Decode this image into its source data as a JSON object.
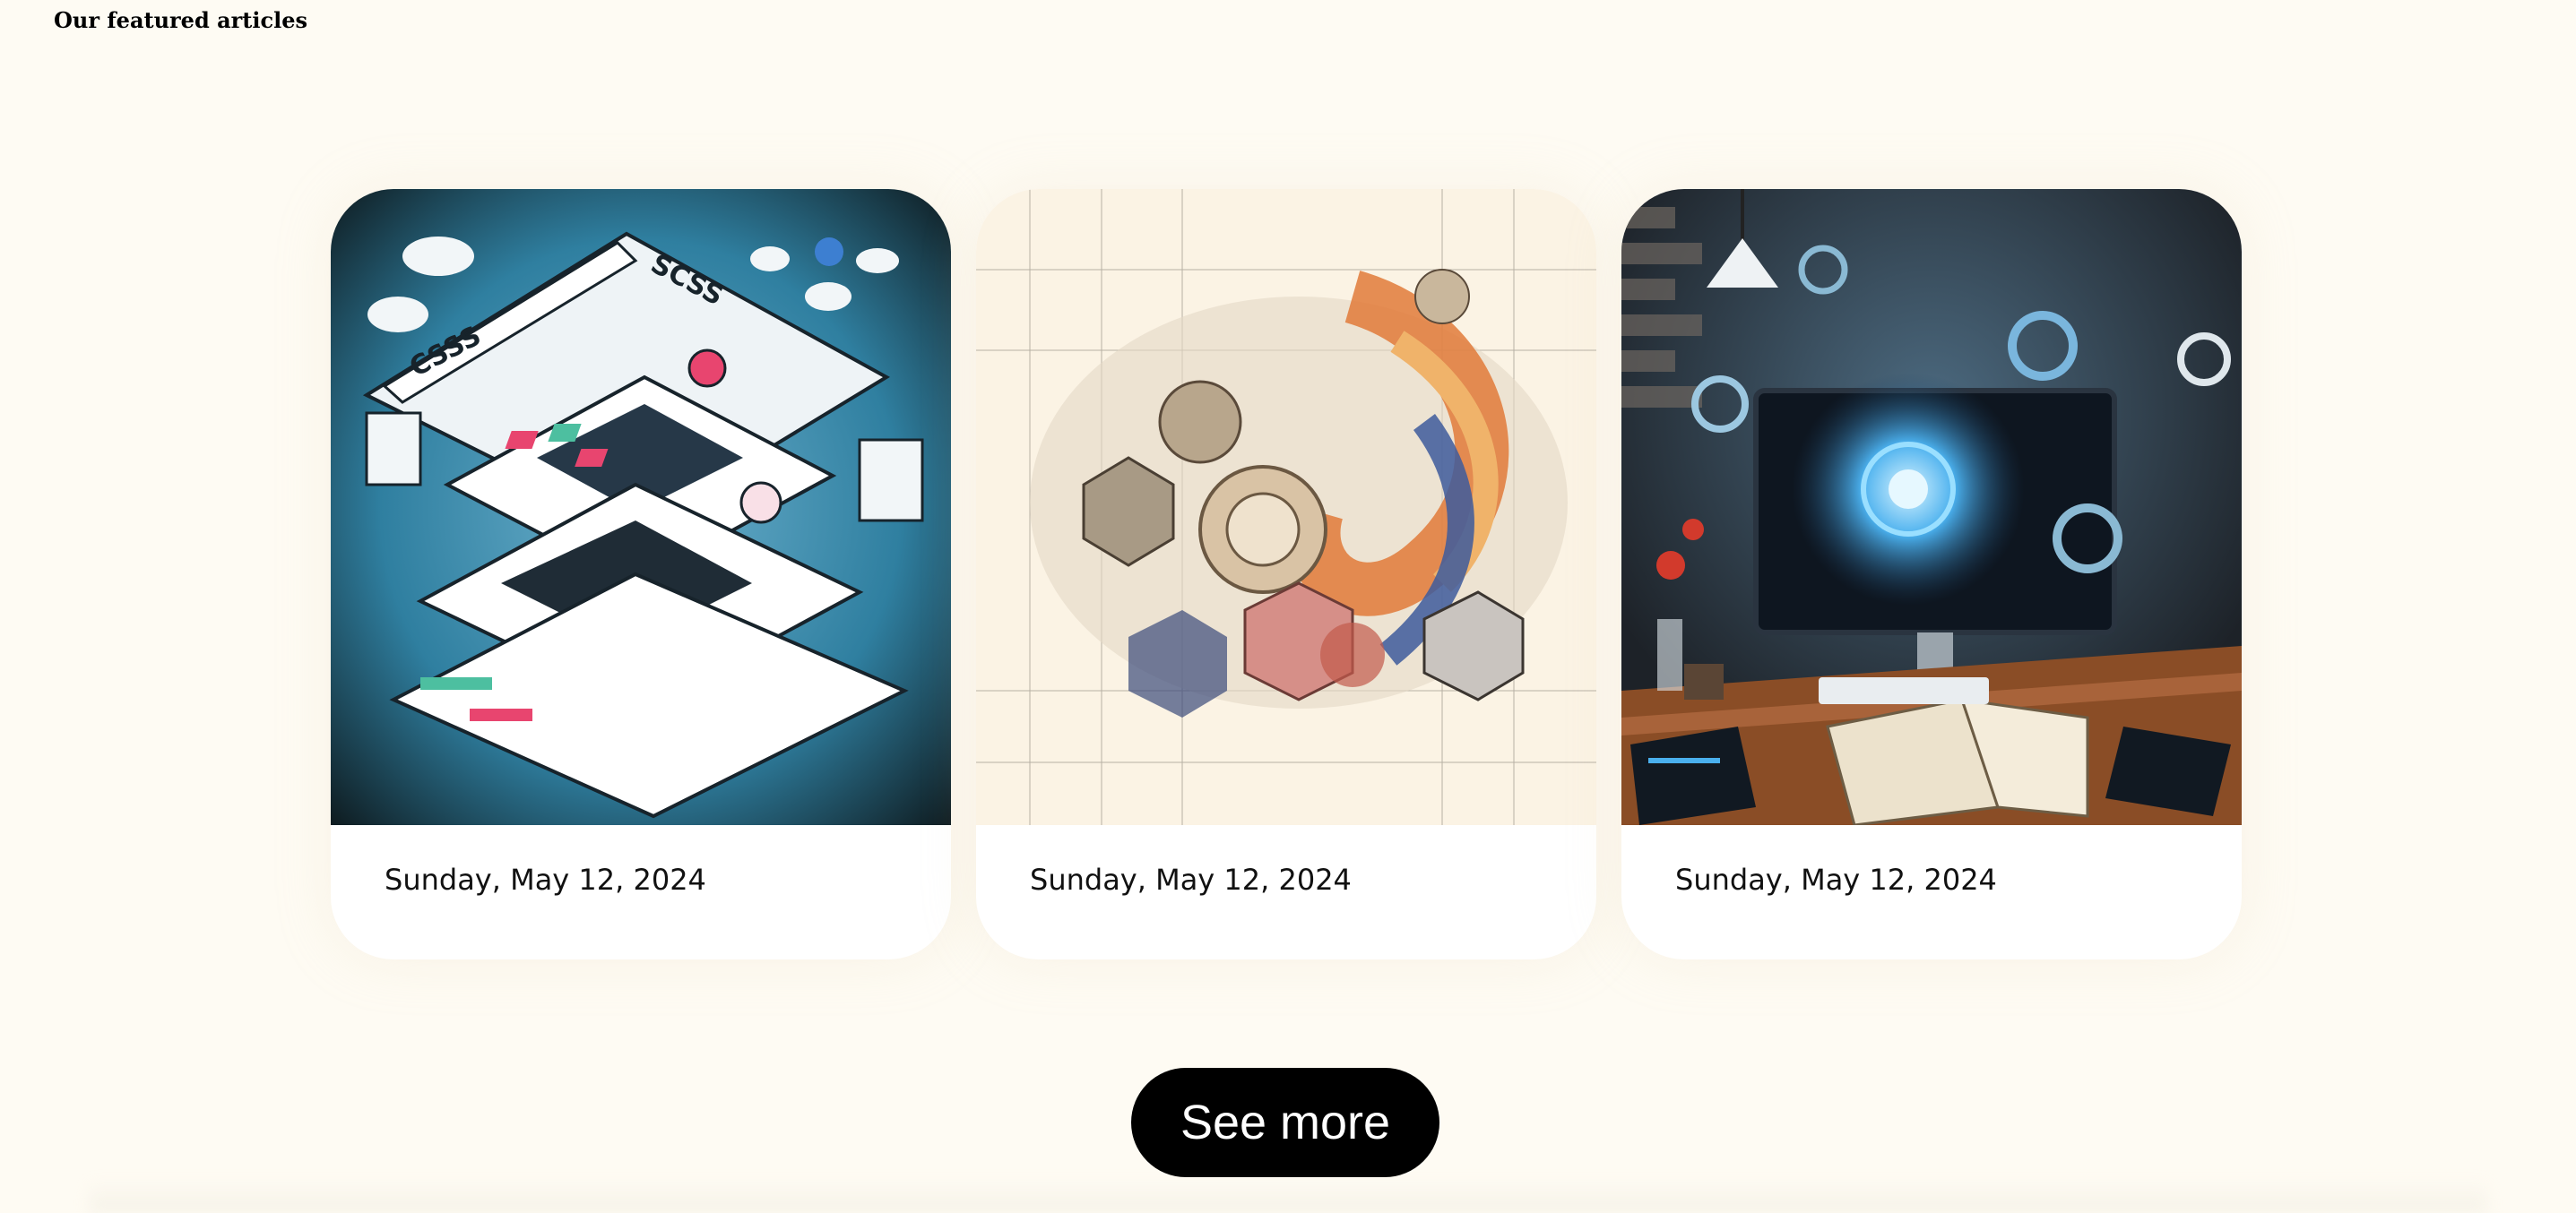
{
  "page": {
    "title": "Our featured articles",
    "background": "#fefbf3"
  },
  "articles": [
    {
      "date": "Sunday, May 12, 2024",
      "image_icon": "css-scss-isometric-illustration"
    },
    {
      "date": "Sunday, May 12, 2024",
      "image_icon": "abstract-geometric-swirl-illustration"
    },
    {
      "date": "Sunday, May 12, 2024",
      "image_icon": "developer-desk-workspace-illustration"
    }
  ],
  "actions": {
    "see_more_label": "See more"
  }
}
